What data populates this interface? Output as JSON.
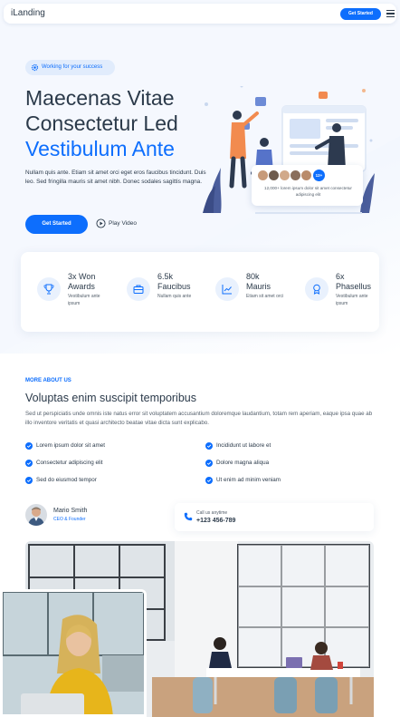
{
  "header": {
    "logo": "iLanding",
    "cta": "Get Started"
  },
  "hero": {
    "badge": "Working for your success",
    "title_line1": "Maecenas Vitae",
    "title_line2": "Consectetur Led",
    "title_accent": "Vestibulum Ante",
    "paragraph": "Nullam quis ante. Etiam sit amet orci eget eros faucibus tincidunt. Duis leo. Sed fringilla mauris sit amet nibh. Donec sodales sagittis magna.",
    "primary_button": "Get Started",
    "video_button": "Play Video",
    "customers": {
      "more_badge": "12+",
      "text": "12,000+ lorem ipsum dolor sit amet consectetur adipiscing elit"
    }
  },
  "stats": [
    {
      "number": "3x Won",
      "label": "Awards",
      "desc": "Vestibulum ante ipsum",
      "icon": "trophy-icon"
    },
    {
      "number": "6.5k",
      "label": "Faucibus",
      "desc": "Nullam quis ante",
      "icon": "briefcase-icon"
    },
    {
      "number": "80k",
      "label": "Mauris",
      "desc": "Etiam sit amet orci",
      "icon": "graph-up-icon"
    },
    {
      "number": "6x",
      "label": "Phasellus",
      "desc": "Vestibulum ante ipsum",
      "icon": "award-icon"
    }
  ],
  "about": {
    "eyebrow": "MORE ABOUT US",
    "title": "Voluptas enim suscipit temporibus",
    "paragraph": "Sed ut perspiciatis unde omnis iste natus error sit voluptatem accusantium doloremque laudantium, totam rem aperiam, eaque ipsa quae ab illo inventore veritatis et quasi architecto beatae vitae dicta sunt explicabo.",
    "features": [
      "Lorem ipsum dolor sit amet",
      "Incididunt ut labore et",
      "Consectetur adipiscing elit",
      "Dolore magna aliqua",
      "Sed do eiusmod tempor",
      "Ut enim ad minim veniam"
    ],
    "profile": {
      "name": "Mario Smith",
      "role": "CEO & Founder"
    },
    "contact": {
      "label": "Call us anytime",
      "phone": "+123 456-789"
    }
  },
  "colors": {
    "accent": "#0d6efd",
    "heading": "#2b3a4a",
    "muted": "#55606c"
  }
}
